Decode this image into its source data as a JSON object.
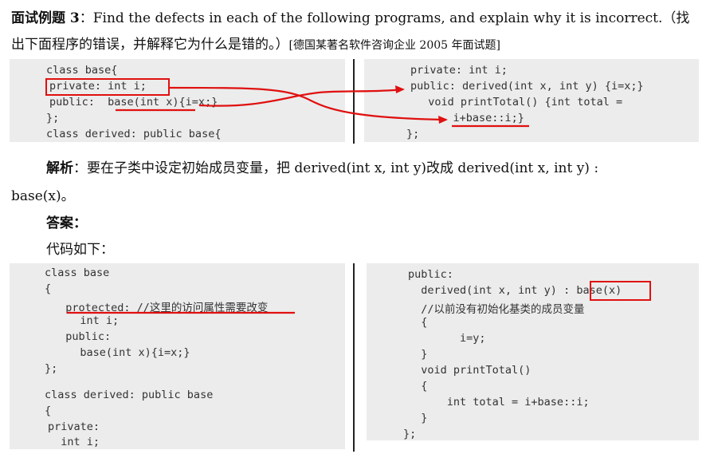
{
  "question": {
    "title_bold": "面试例题 3",
    "colon": "：",
    "title_text": "Find the defects in each of the following programs, and explain why it is incorrect.（找",
    "line2_text": "出下面程序的错误，并解释它为什么是错的。）",
    "source": "[德国某著名软件咨询企业 2005 年面试题]"
  },
  "snippet_left": [
    "class base{",
    "private: int i;",
    "public:  base(int x){i=x;}",
    "};",
    "class derived: public base{"
  ],
  "snippet_right": [
    "private: int i;",
    "public: derived(int x, int y) {i=x;}",
    "  void printTotal() {int total =",
    "    i+base::i;}",
    "};"
  ],
  "analysis": {
    "label": "解析",
    "text": "：要在子类中设定初始成员变量，把 derived(int x, int y)改成 derived(int x, int y) :",
    "text2": "base(x)。"
  },
  "answer_label": "答案：",
  "code_intro": "代码如下：",
  "answer_left": [
    "class base",
    "{",
    "  protected: //这里的访问属性需要改变",
    "   int i;",
    "  public:",
    "   base(int x){i=x;}",
    "};",
    "class derived: public base",
    "{",
    "private:",
    "  int i;"
  ],
  "answer_right": [
    "public:",
    "  derived(int x, int y) : base(x)",
    "  //以前没有初始化基类的成员变量",
    "  {",
    "        i=y;",
    "  }",
    "  void printTotal()",
    "  {",
    "      int total = i+base::i;",
    "  }",
    "};"
  ],
  "colors": {
    "annotation_red": "#e01010",
    "panel_bg": "#ececec"
  }
}
